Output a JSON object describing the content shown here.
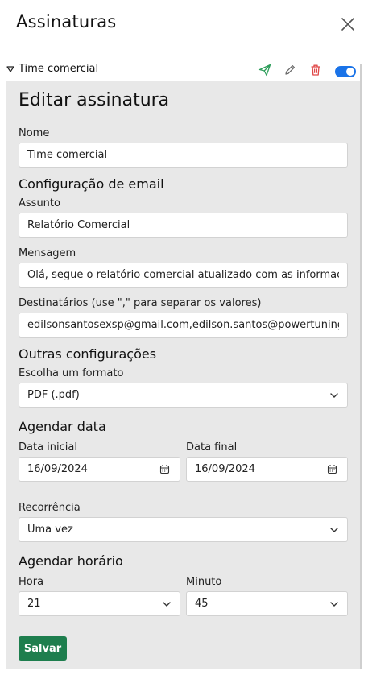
{
  "header": {
    "title": "Assinaturas"
  },
  "item": {
    "name": "Time comercial",
    "enabled": true,
    "accent_color": "#1a73e8"
  },
  "form": {
    "title": "Editar assinatura",
    "name_label": "Nome",
    "name_value": "Time comercial",
    "email_section": "Configuração de email",
    "subject_label": "Assunto",
    "subject_value": "Relatório Comercial",
    "message_label": "Mensagem",
    "message_value": "Olá, segue o relatório comercial atualizado com as informaçõ",
    "recipients_label": "Destinatários (use \",\" para separar os valores)",
    "recipients_value": "edilsonsantosexsp@gmail.com,edilson.santos@powertuning.c",
    "other_section": "Outras configurações",
    "format_label": "Escolha um formato",
    "format_value": "PDF (.pdf)",
    "schedule_date_section": "Agendar data",
    "start_date_label": "Data inicial",
    "start_date_value": "16/09/2024",
    "end_date_label": "Data final",
    "end_date_value": "16/09/2024",
    "recurrence_label": "Recorrência",
    "recurrence_value": "Uma vez",
    "schedule_time_section": "Agendar horário",
    "hour_label": "Hora",
    "hour_value": "21",
    "minute_label": "Minuto",
    "minute_value": "45",
    "save_label": "Salvar",
    "save_color": "#1e7e4e"
  }
}
